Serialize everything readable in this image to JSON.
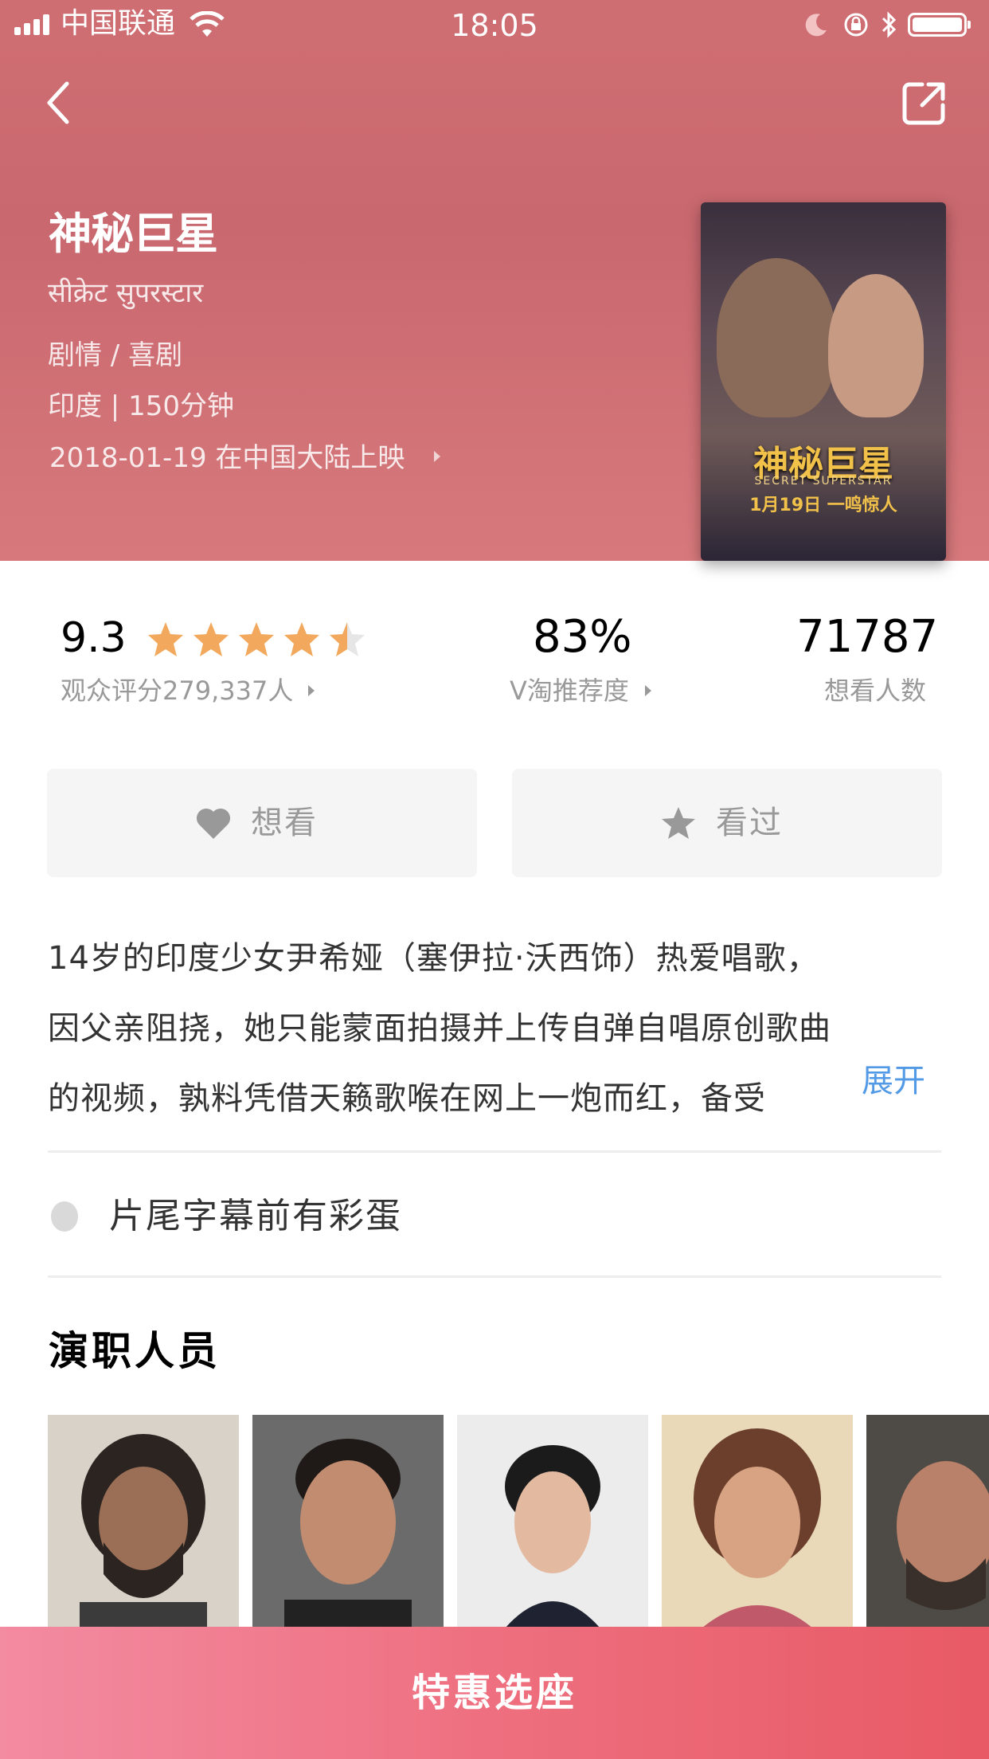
{
  "status_bar": {
    "carrier": "中国联通",
    "time": "18:05"
  },
  "movie": {
    "title": "神秘巨星",
    "original_title": "सीक्रेट सुपरस्टार",
    "genre": "剧情 / 喜剧",
    "country_duration": "印度 | 150分钟",
    "release": "2018-01-19 在中国大陆上映",
    "poster": {
      "title": "神秘巨星",
      "subtitle": "SECRET SUPERSTAR",
      "date": "1月19日 一鸣惊人"
    }
  },
  "stats": {
    "rating": "9.3",
    "stars_filled": 4.5,
    "stars_total": 5,
    "rating_label": "观众评分279,337人",
    "recommend": "83%",
    "recommend_label": "V淘推荐度",
    "want": "71787",
    "want_label": "想看人数"
  },
  "actions": {
    "want_label": "想看",
    "seen_label": "看过"
  },
  "synopsis": {
    "lines": [
      "14岁的印度少女尹希娅（塞伊拉·沃西饰）热爱唱歌，",
      "因父亲阻挠，她只能蒙面拍摄并上传自弹自唱原创歌曲",
      "的视频，孰料凭借天籁歌喉在网上一炮而红，备受"
    ],
    "expand_label": "展开"
  },
  "egg": {
    "text": "片尾字幕前有彩蛋"
  },
  "cast": {
    "title": "演职人员",
    "count": 5
  },
  "cta": {
    "label": "特惠选座"
  },
  "colors": {
    "star": "#f2a95d",
    "gray_text": "#999999",
    "button_bg": "#f5f5f5",
    "body_text": "#333333",
    "link": "#539ae6",
    "divider": "#ededed",
    "cta": "#ef6a78"
  }
}
